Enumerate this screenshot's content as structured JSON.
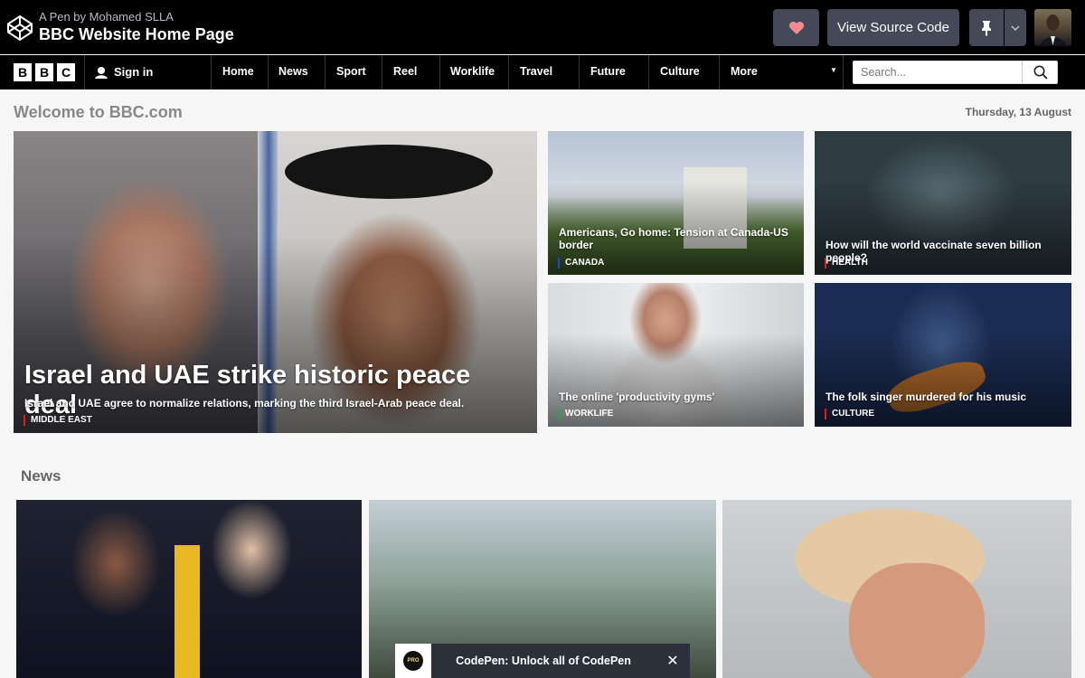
{
  "codepen": {
    "byline": "A Pen by Mohamed SLLA",
    "title": "BBC Website Home Page",
    "view_source": "View Source Code"
  },
  "bbc_nav": {
    "logo": [
      "B",
      "B",
      "C"
    ],
    "signin": "Sign in",
    "items": [
      "Home",
      "News",
      "Sport",
      "Reel",
      "Worklife",
      "Travel",
      "Future",
      "Culture",
      "More"
    ],
    "search_placeholder": "Search..."
  },
  "welcome": "Welcome to BBC.com",
  "date": "Thursday, 13 August",
  "stories": [
    {
      "headline": "Israel and UAE strike historic peace deal",
      "summary": "Israel and UAE agree to normalize relations, marking the third Israel-Arab peace deal.",
      "tag": "MIDDLE EAST",
      "tag_color": "#e31b23"
    },
    {
      "headline": "Americans, Go home: Tension at Canada-US border",
      "tag": "CANADA",
      "tag_color": "#1a4bd6"
    },
    {
      "headline": "How will the world vaccinate seven billion people?",
      "tag": "HEALTH",
      "tag_color": "#e31b23"
    },
    {
      "headline": "The online 'productivity gyms'",
      "tag": "WORKLIFE",
      "tag_color": "#1fa84a"
    },
    {
      "headline": "The folk singer murdered for his music",
      "tag": "CULTURE",
      "tag_color": "#e31b23"
    }
  ],
  "news_heading": "News",
  "promo": {
    "text": "CodePen: Unlock all of CodePen",
    "badge": "PRO",
    "close": "✕"
  },
  "colors": {
    "cp_button": "#444857",
    "heart": "#f28b8b",
    "nav_bg": "#000000"
  }
}
